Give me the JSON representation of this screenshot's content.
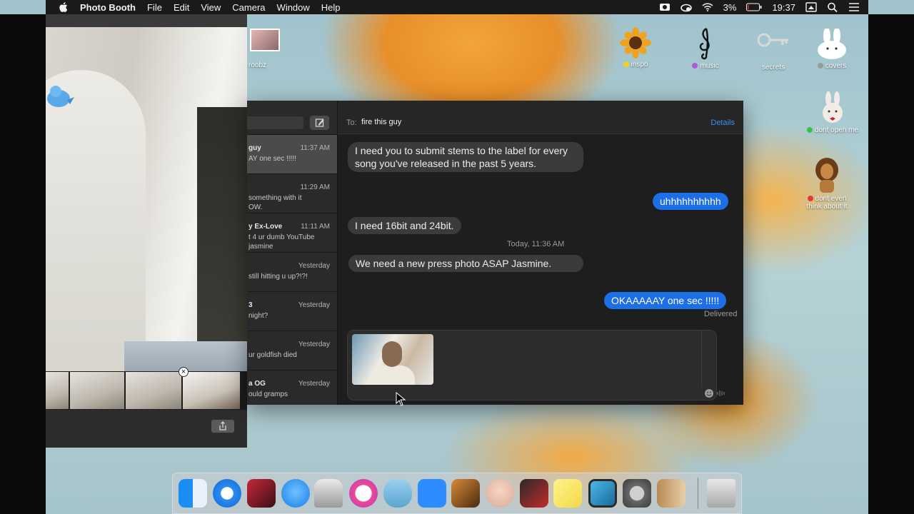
{
  "menubar": {
    "app_name": "Photo Booth",
    "menus": [
      "File",
      "Edit",
      "View",
      "Camera",
      "Window",
      "Help"
    ],
    "battery": "3%",
    "clock": "19:37"
  },
  "desktop_icons": {
    "roobz": "roobz",
    "inspo": "inspo",
    "music": "music",
    "secrets": "secrets",
    "covers": "covers",
    "dont_open_me": "dont open me",
    "dont_even_think_line1": "dont even",
    "dont_even_think_line2": "think about it"
  },
  "colors": {
    "blue_bubble": "#1d6fe6",
    "gray_bubble": "#3b3b3d",
    "details_link": "#3d8fe8"
  },
  "messages_app": {
    "to_label": "To:",
    "recipient": "fire this guy",
    "details": "Details",
    "conversations": [
      {
        "name": "guy",
        "time": "11:37 AM",
        "preview": "AY one sec !!!!!",
        "selected": true
      },
      {
        "name": "",
        "time": "11:29 AM",
        "preview": "something with it\nOW."
      },
      {
        "name": "y Ex-Love",
        "time": "11:11 AM",
        "preview": "t 4 ur dumb YouTube\njasmine"
      },
      {
        "name": "",
        "time": "Yesterday",
        "preview": "still hitting u up?!?!"
      },
      {
        "name": "3",
        "time": "Yesterday",
        "preview": "night?"
      },
      {
        "name": "",
        "time": "Yesterday",
        "preview": "ur goldfish died"
      },
      {
        "name": "a OG",
        "time": "Yesterday",
        "preview": "ould gramps"
      }
    ],
    "thread": {
      "msg1": "I need you to submit stems to the label for every song you've released in the past 5 years.",
      "msg2": "uhhhhhhhhhh",
      "msg3": "I need 16bit and 24bit.",
      "timestamp": "Today, 11:36 AM",
      "msg4": "We need a new press photo ASAP Jasmine.",
      "msg5": "OKAAAAAY one sec !!!!!",
      "delivered": "Delivered"
    }
  },
  "dock": {
    "apps": [
      "finder-icon",
      "safari-icon",
      "photo-booth-icon",
      "messages-icon",
      "inkscape-icon",
      "itunes-icon",
      "sequel-pro-icon",
      "zoom-icon",
      "garageband-icon",
      "face-app-icon",
      "flashcard-icon",
      "stickies-icon",
      "preview-icon",
      "system-preferences-icon",
      "contacts-icon",
      "trash-icon"
    ]
  }
}
